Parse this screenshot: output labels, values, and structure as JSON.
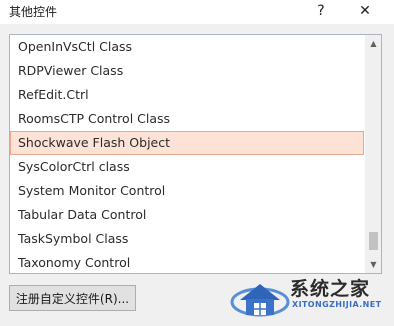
{
  "window": {
    "title": "其他控件",
    "help_label": "?",
    "close_label": "✕"
  },
  "list": {
    "items": [
      {
        "label": "OpenInVsCtl Class",
        "selected": false
      },
      {
        "label": "RDPViewer Class",
        "selected": false
      },
      {
        "label": "RefEdit.Ctrl",
        "selected": false
      },
      {
        "label": "RoomsCTP Control Class",
        "selected": false
      },
      {
        "label": "Shockwave Flash Object",
        "selected": true
      },
      {
        "label": "SysColorCtrl class",
        "selected": false
      },
      {
        "label": "System Monitor Control",
        "selected": false
      },
      {
        "label": "Tabular Data Control",
        "selected": false
      },
      {
        "label": "TaskSymbol Class",
        "selected": false
      },
      {
        "label": "Taxonomy Control",
        "selected": false
      }
    ],
    "scroll_up_icon": "▲",
    "scroll_down_icon": "▼"
  },
  "register_button": {
    "label": "注册自定义控件(R)..."
  },
  "watermark": {
    "text": "系统之家",
    "url": "XITONGZHIJIA.NET"
  },
  "colors": {
    "selected_bg": "#fde2d6",
    "selected_border": "#e8a78e",
    "watermark_blue": "#3a6fc4"
  }
}
